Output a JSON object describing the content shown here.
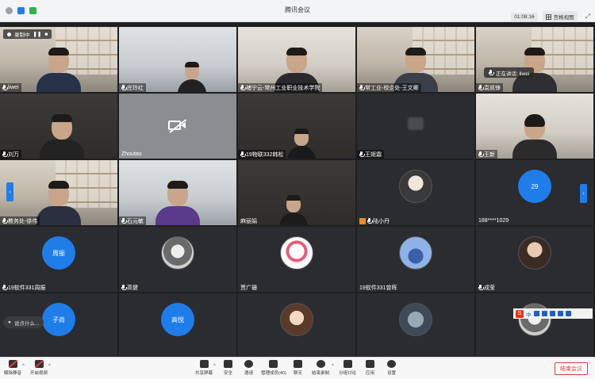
{
  "window": {
    "title": "腾讯会议",
    "timer": "01:08:16",
    "view_label": "宫格视图"
  },
  "recording": {
    "label": "录制中"
  },
  "speaker": {
    "label": "正在讲话: liwei"
  },
  "tiles": [
    {
      "name": "liwei",
      "kind": "video"
    },
    {
      "name": "庄玲红",
      "kind": "video"
    },
    {
      "name": "褚宁云-常州工业职业技术学院",
      "kind": "video"
    },
    {
      "name": "常工业-校企处-王文卿",
      "kind": "video"
    },
    {
      "name": "袁凯锋",
      "kind": "video"
    },
    {
      "name": "刘万",
      "kind": "video"
    },
    {
      "name": "Zhoutao",
      "kind": "camoff"
    },
    {
      "name": "19物联332韩松",
      "kind": "video"
    },
    {
      "name": "王姬霜",
      "kind": "blur"
    },
    {
      "name": "王新",
      "kind": "video"
    },
    {
      "name": "教务处-徐伟",
      "kind": "video"
    },
    {
      "name": "石元敏",
      "kind": "video"
    },
    {
      "name": "麻丽娟",
      "kind": "video"
    },
    {
      "name": "陆小丹",
      "kind": "avatar"
    },
    {
      "name": "188****1029",
      "kind": "avatar-blue",
      "avatar_text": "29"
    },
    {
      "name": "19软件331周振",
      "kind": "avatar-blue",
      "avatar_text": "周振"
    },
    {
      "name": "高健",
      "kind": "avatar"
    },
    {
      "name": "贾广珊",
      "kind": "avatar"
    },
    {
      "name": "19软件331曾晖",
      "kind": "avatar"
    },
    {
      "name": "成莹",
      "kind": "avatar"
    },
    {
      "name": "",
      "kind": "avatar-blue",
      "avatar_text": "子尚"
    },
    {
      "name": "",
      "kind": "avatar-blue",
      "avatar_text": "高悦"
    },
    {
      "name": "",
      "kind": "avatar"
    },
    {
      "name": "",
      "kind": "avatar"
    },
    {
      "name": "",
      "kind": "avatar"
    }
  ],
  "chat_pill": {
    "label": "说点什么..."
  },
  "ime": {
    "logo": "S",
    "mode": "中"
  },
  "toolbar": {
    "mute": "解除静音",
    "video": "开启视频",
    "share": "共享屏幕",
    "security": "安全",
    "invite": "邀请",
    "members": "管理成员(40)",
    "chat": "聊天",
    "record": "结束录制",
    "breakout": "分组讨论",
    "apps": "应用",
    "settings": "设置",
    "end": "结束会议"
  },
  "colors": {
    "accent_blue": "#1f7dea",
    "end_red": "#e53935"
  }
}
